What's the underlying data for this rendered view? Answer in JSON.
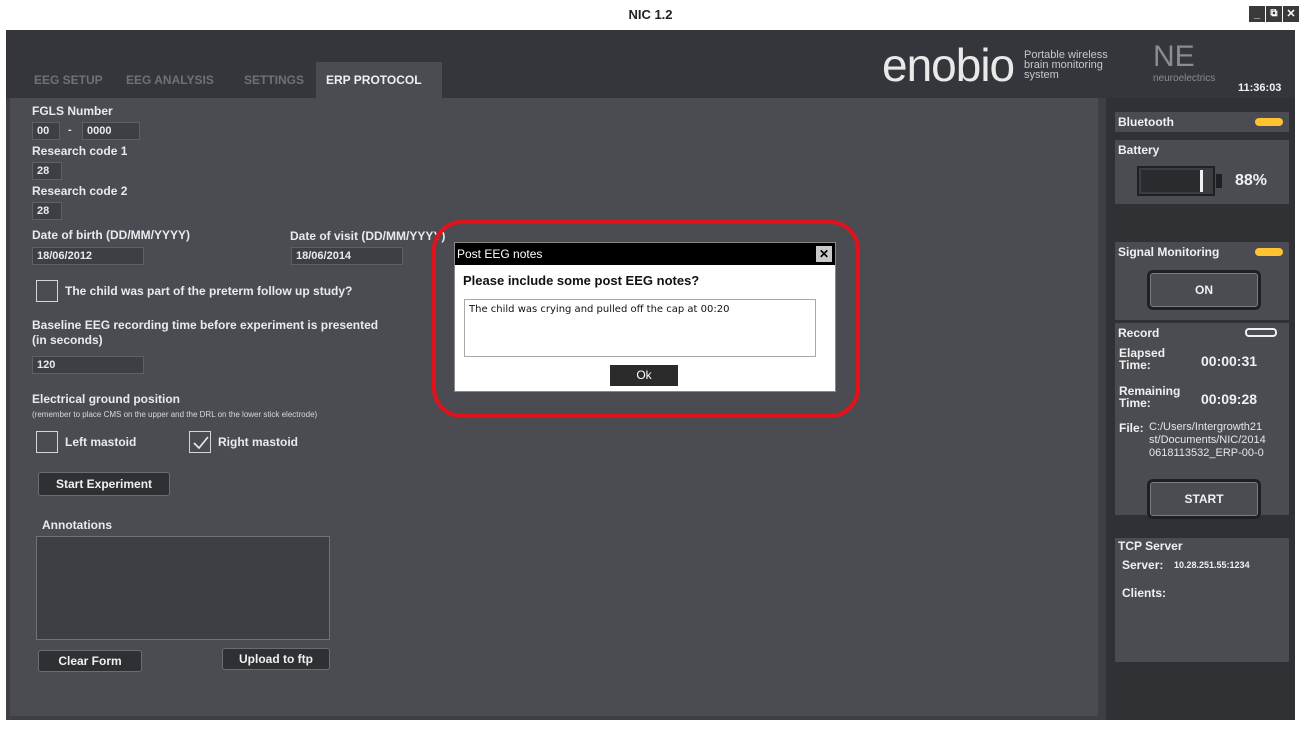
{
  "window": {
    "title": "NIC 1.2",
    "minimize": "_",
    "restore": "⧉",
    "close": "✕"
  },
  "tabs": [
    "EEG SETUP",
    "EEG ANALYSIS",
    "SETTINGS",
    "ERP PROTOCOL"
  ],
  "brand": {
    "name": "enobio",
    "tagline_1": "Portable wireless",
    "tagline_2": "brain monitoring",
    "tagline_3": "system",
    "logo_mark": "NE",
    "logo_text": "neuroelectrics",
    "clock": "11:36:03"
  },
  "form": {
    "fgls_label": "FGLS Number",
    "fgls_part1": "00",
    "fgls_sep": "-",
    "fgls_part2": "0000",
    "research1_label": "Research code 1",
    "research1_value": "28",
    "research2_label": "Research code 2",
    "research2_value": "28",
    "dob_label": "Date of birth (DD/MM/YYYY)",
    "dob_value": "18/06/2012",
    "dov_label": "Date of visit (DD/MM/YYYY)",
    "dov_value": "18/06/2014",
    "preterm_label": "The child was part of the preterm follow up study?",
    "baseline_label_1": "Baseline EEG recording time before experiment is presented",
    "baseline_label_2": "(in seconds)",
    "baseline_value": "120",
    "ground_label": "Electrical ground position",
    "ground_note": "(remember to place CMS on the upper and the DRL on the lower stick electrode)",
    "left_mastoid": "Left mastoid",
    "right_mastoid": "Right mastoid",
    "start_experiment": "Start Experiment",
    "annotations_label": "Annotations",
    "clear_form": "Clear Form",
    "upload_ftp": "Upload to ftp"
  },
  "sidebar": {
    "bluetooth": "Bluetooth",
    "battery": "Battery",
    "battery_percent": "88%",
    "battery_level": 0.88,
    "signal_monitoring": "Signal Monitoring",
    "on_button": "ON",
    "record": "Record",
    "elapsed_label_1": "Elapsed",
    "elapsed_label_2": "Time:",
    "elapsed_value": "00:00:31",
    "remaining_label_1": "Remaining",
    "remaining_label_2": "Time:",
    "remaining_value": "00:09:28",
    "file_label": "File:",
    "file_line_1": "C:/Users/Intergrowth21",
    "file_line_2": "st/Documents/NIC/2014",
    "file_line_3": "0618113532_ERP-00-0",
    "start_button": "START",
    "tcp_server": "TCP Server",
    "server_label": "Server:",
    "server_value": "10.28.251.55:1234",
    "clients_label": "Clients:",
    "colors": {
      "status_orange": "#ffc233",
      "panel": "#4a4c52"
    }
  },
  "dialog": {
    "title": "Post EEG notes",
    "close": "✕",
    "prompt": "Please include some post EEG notes?",
    "input_value": "The child was crying and pulled off the cap at 00:20",
    "ok": "Ok"
  },
  "highlight_color": "#e3111a"
}
